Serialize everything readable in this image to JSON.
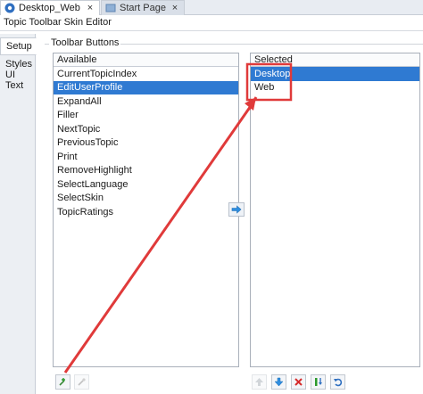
{
  "tabs": [
    {
      "label": "Desktop_Web",
      "icon": "topic-toolbar-skin-icon",
      "active": true
    },
    {
      "label": "Start Page",
      "icon": "start-page-icon",
      "active": false
    }
  ],
  "editor_title": "Topic Toolbar Skin Editor",
  "side_tabs": [
    "Setup",
    "Styles",
    "UI Text"
  ],
  "group_label": "Toolbar Buttons",
  "available": {
    "header": "Available",
    "items": [
      "CurrentTopicIndex",
      "EditUserProfile",
      "ExpandAll",
      "Filler",
      "NextTopic",
      "PreviousTopic",
      "Print",
      "RemoveHighlight",
      "SelectLanguage",
      "SelectSkin",
      "TopicRatings"
    ],
    "selected_index": 1
  },
  "selected": {
    "header": "Selected",
    "items": [
      "Desktop",
      "Web"
    ],
    "selected_index": 0
  },
  "colors": {
    "selection": "#2f7ad2",
    "annotation": "#e03a3a"
  }
}
